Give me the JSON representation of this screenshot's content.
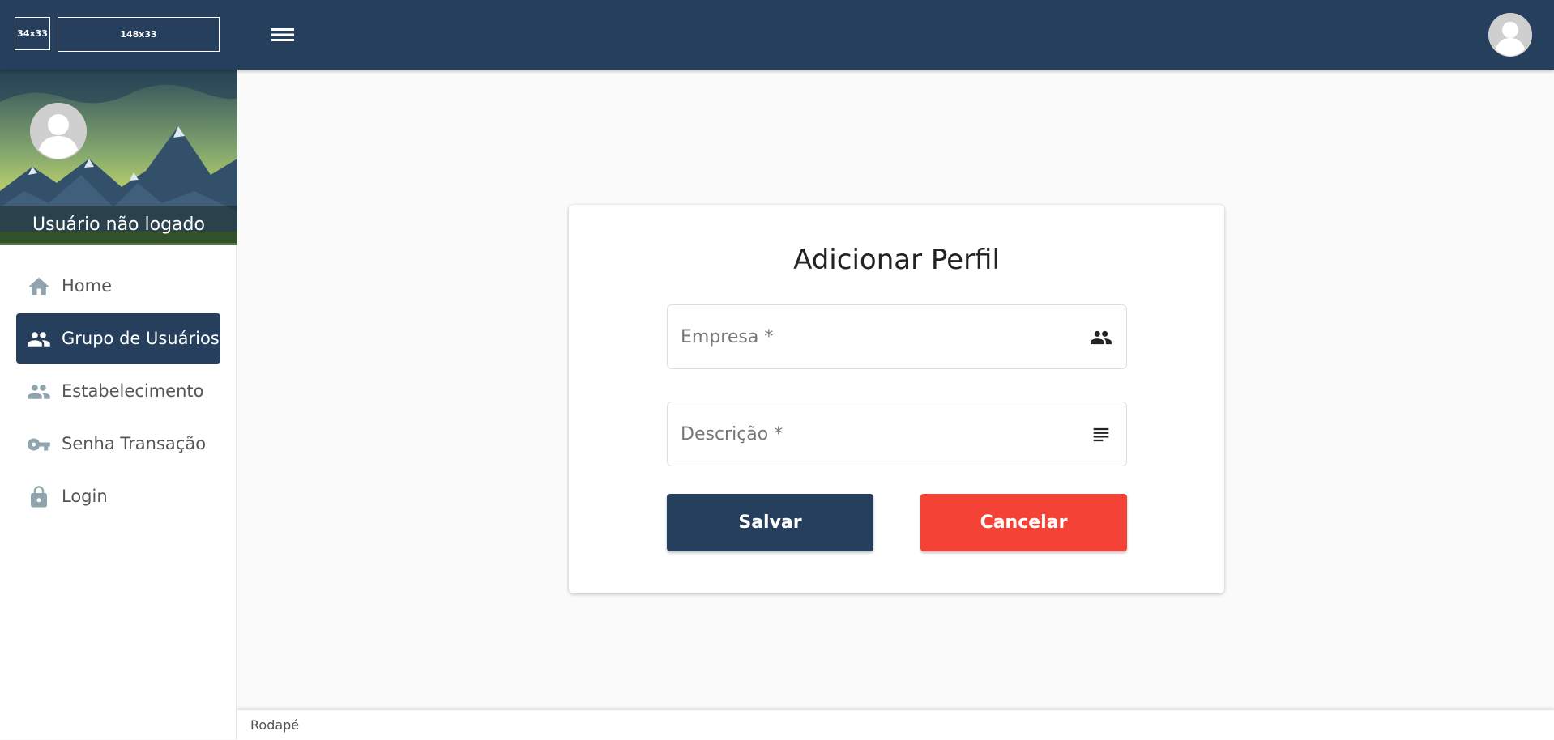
{
  "topbar": {
    "logo_small": "34x33",
    "logo_large": "148x33",
    "menu_icon": "hamburger-menu-icon",
    "avatar_icon": "user-avatar-icon",
    "color": "#253f5c"
  },
  "sidebar": {
    "user_status": "Usuário não logado",
    "items": [
      {
        "label": "Home",
        "icon": "home-icon",
        "active": false
      },
      {
        "label": "Grupo de Usuários",
        "icon": "people-icon",
        "active": true
      },
      {
        "label": "Estabelecimento",
        "icon": "people-icon",
        "active": false
      },
      {
        "label": "Senha Transação",
        "icon": "key-icon",
        "active": false
      },
      {
        "label": "Login",
        "icon": "lock-icon",
        "active": false
      }
    ]
  },
  "form": {
    "title": "Adicionar Perfil",
    "empresa_placeholder": "Empresa *",
    "empresa_value": "",
    "descricao_placeholder": "Descrição *",
    "descricao_value": "",
    "save_label": "Salvar",
    "cancel_label": "Cancelar",
    "save_color": "#253f5c",
    "cancel_color": "#f44336"
  },
  "footer": {
    "text": "Rodapé"
  }
}
